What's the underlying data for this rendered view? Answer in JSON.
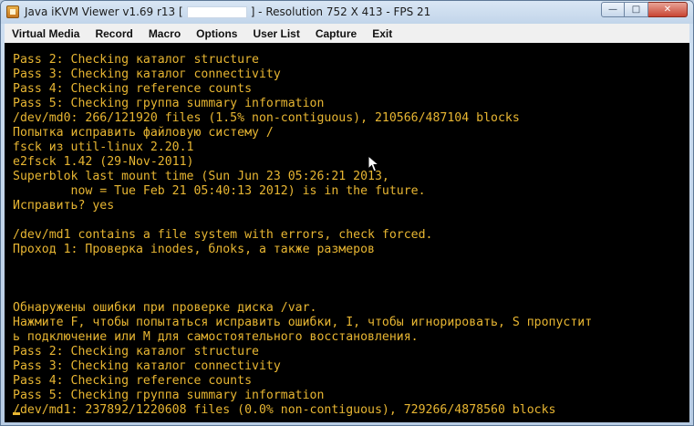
{
  "window": {
    "title_prefix": "Java iKVM Viewer v1.69 r13 [",
    "title_suffix": "] - Resolution 752 X 413 - FPS 21",
    "controls": {
      "minimize": "—",
      "maximize": "□",
      "close": "✕"
    }
  },
  "menu": {
    "items": [
      "Virtual Media",
      "Record",
      "Macro",
      "Options",
      "User List",
      "Capture",
      "Exit"
    ]
  },
  "console": {
    "lines": [
      "Pass 2: Checking каталог structure",
      "Pass 3: Checking каталог connectivity",
      "Pass 4: Checking reference counts",
      "Pass 5: Checking группа summary information",
      "/dev/md0: 266/121920 files (1.5% non-contiguous), 210566/487104 blocks",
      "Попытка исправить файловую систему /",
      "fsck из util-linux 2.20.1",
      "e2fsck 1.42 (29-Nov-2011)",
      "Superblok last mount time (Sun Jun 23 05:26:21 2013,",
      "        now = Tue Feb 21 05:40:13 2012) is in the future.",
      "Исправить? yes",
      "",
      "/dev/md1 contains a file system with errors, check forced.",
      "Проход 1: Проверка inodes, блоks, а также размеров",
      "",
      "",
      "",
      "Обнаружены ошибки при проверке диска /var.",
      "Нажмите F, чтобы попытаться исправить ошибки, I, чтобы игнорировать, S пропустит",
      "ь подключение или M для самостоятельного восстановления.",
      "Pass 2: Checking каталог structure",
      "Pass 3: Checking каталог connectivity",
      "Pass 4: Checking reference counts",
      "Pass 5: Checking группа summary information",
      "/dev/md1: 237892/1220608 files (0.0% non-contiguous), 729266/4878560 blocks"
    ],
    "text_color": "#e8b632",
    "background": "#000000"
  }
}
